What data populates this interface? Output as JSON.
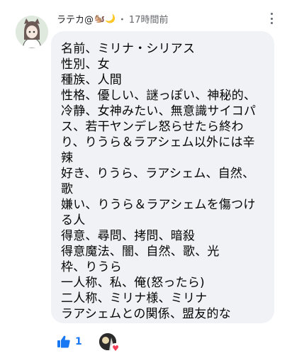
{
  "comment": {
    "author": "ラテカ@",
    "author_emojis": "🐿️🌙",
    "separator": "・",
    "time": "17時間前",
    "text": "名前、ミリナ・シリアス\n性別、女\n種族、人間\n性格、優しい、謎っぽい、神秘的、\n冷静、女神みたい、無意識サイコパ\nス、若干ヤンデレ怒らせたら終わ\nり、りうら＆ラアシェム以外には辛\n辣\n好き、りうら、ラアシェム、自然、\n歌\n嫌い、りうら＆ラアシェムを傷つけ\nる人\n得意、尋問、拷問、暗殺\n得意魔法、闇、自然、歌、光\n枠、りうら\n一人称、私、俺(怒ったら)\n二人称、ミリナ様、ミリナ\nラアシェムとの関係、盟友的な",
    "like_count": "1",
    "reaction": "heart"
  },
  "colors": {
    "bubble": "#f0f2f5",
    "like_blue": "#1877f2",
    "meta_gray": "#65676b",
    "heart_red": "#f33e58"
  }
}
